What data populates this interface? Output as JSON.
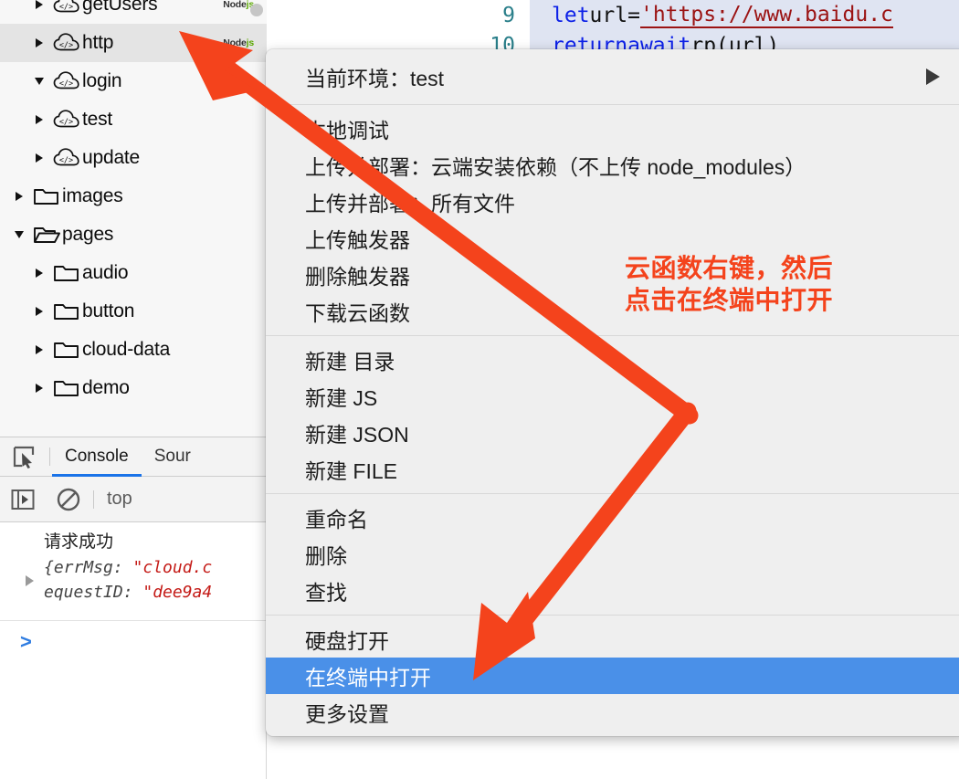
{
  "file_tree": {
    "items": [
      {
        "label": "getUsers",
        "icon": "cloud-code-icon",
        "depth": 2,
        "twisty": "right",
        "badge": "Node",
        "badge_js": "js",
        "selected": false
      },
      {
        "label": "http",
        "icon": "cloud-code-icon",
        "depth": 2,
        "twisty": "right",
        "badge": "Node",
        "badge_js": "js",
        "selected": true
      },
      {
        "label": "login",
        "icon": "cloud-code-icon",
        "depth": 2,
        "twisty": "down",
        "badge": "",
        "badge_js": "",
        "selected": false
      },
      {
        "label": "test",
        "icon": "cloud-code-icon",
        "depth": 2,
        "twisty": "right",
        "badge": "",
        "badge_js": "",
        "selected": false
      },
      {
        "label": "update",
        "icon": "cloud-code-icon",
        "depth": 2,
        "twisty": "right",
        "badge": "",
        "badge_js": "",
        "selected": false
      },
      {
        "label": "images",
        "icon": "folder-closed-icon",
        "depth": 1,
        "twisty": "right",
        "badge": "",
        "badge_js": "",
        "selected": false
      },
      {
        "label": "pages",
        "icon": "folder-open-icon",
        "depth": 1,
        "twisty": "down",
        "badge": "",
        "badge_js": "",
        "selected": false
      },
      {
        "label": "audio",
        "icon": "folder-closed-icon",
        "depth": 2,
        "twisty": "right",
        "badge": "",
        "badge_js": "",
        "selected": false
      },
      {
        "label": "button",
        "icon": "folder-closed-icon",
        "depth": 2,
        "twisty": "right",
        "badge": "",
        "badge_js": "",
        "selected": false
      },
      {
        "label": "cloud-data",
        "icon": "folder-closed-icon",
        "depth": 2,
        "twisty": "right",
        "badge": "",
        "badge_js": "",
        "selected": false
      },
      {
        "label": "demo",
        "icon": "folder-closed-icon",
        "depth": 2,
        "twisty": "right",
        "badge": "",
        "badge_js": "",
        "selected": false
      }
    ]
  },
  "devtools": {
    "inspect_icon": "inspect-element-icon",
    "tabs": [
      {
        "label": "Console",
        "active": true
      },
      {
        "label": "Sour",
        "active": false
      }
    ],
    "toolbar": {
      "sidebar_icon": "console-sidebar-icon",
      "clear_icon": "clear-console-icon",
      "context_label": "top"
    },
    "console": {
      "log_text": "请求成功",
      "object_line1_prefix": "{errMsg: ",
      "object_line1_string": "\"cloud.c",
      "object_line2_prefix": "equestID: ",
      "object_line2_string": "\"dee9a4",
      "prompt": ">"
    }
  },
  "editor": {
    "lines": [
      {
        "number": "9",
        "tokens": [
          {
            "t": "let ",
            "c": "kw"
          },
          {
            "t": "url ",
            "c": "pl"
          },
          {
            "t": "= ",
            "c": "pl"
          },
          {
            "t": "'",
            "c": "lnk"
          },
          {
            "t": "https://www.baidu.c",
            "c": "lnk"
          }
        ]
      },
      {
        "number": "10",
        "tokens": [
          {
            "t": "return ",
            "c": "kw"
          },
          {
            "t": "await ",
            "c": "kw"
          },
          {
            "t": "rp(url)",
            "c": "pl"
          }
        ]
      }
    ]
  },
  "context_menu": {
    "groups": [
      {
        "items": [
          {
            "label": "当前环境：test",
            "header": true,
            "submenu": true,
            "highlight": false
          }
        ]
      },
      {
        "items": [
          {
            "label": "本地调试",
            "header": false,
            "submenu": false,
            "highlight": false
          },
          {
            "label": "上传并部署：云端安装依赖（不上传 node_modules）",
            "header": false,
            "submenu": false,
            "highlight": false
          },
          {
            "label": "上传并部署：所有文件",
            "header": false,
            "submenu": false,
            "highlight": false
          },
          {
            "label": "上传触发器",
            "header": false,
            "submenu": false,
            "highlight": false
          },
          {
            "label": "删除触发器",
            "header": false,
            "submenu": false,
            "highlight": false
          },
          {
            "label": "下载云函数",
            "header": false,
            "submenu": false,
            "highlight": false
          }
        ]
      },
      {
        "items": [
          {
            "label": "新建 目录",
            "header": false,
            "submenu": false,
            "highlight": false
          },
          {
            "label": "新建 JS",
            "header": false,
            "submenu": false,
            "highlight": false
          },
          {
            "label": "新建 JSON",
            "header": false,
            "submenu": false,
            "highlight": false
          },
          {
            "label": "新建 FILE",
            "header": false,
            "submenu": false,
            "highlight": false
          }
        ]
      },
      {
        "items": [
          {
            "label": "重命名",
            "header": false,
            "submenu": false,
            "highlight": false
          },
          {
            "label": "删除",
            "header": false,
            "submenu": false,
            "highlight": false
          },
          {
            "label": "查找",
            "header": false,
            "submenu": false,
            "highlight": false
          }
        ]
      },
      {
        "items": [
          {
            "label": "硬盘打开",
            "header": false,
            "submenu": false,
            "highlight": false
          },
          {
            "label": "在终端中打开",
            "header": false,
            "submenu": false,
            "highlight": true
          },
          {
            "label": "更多设置",
            "header": false,
            "submenu": false,
            "highlight": false
          }
        ]
      }
    ]
  },
  "annotation": {
    "line1": "云函数右键，然后",
    "line2": "点击在终端中打开",
    "color": "#f4431c",
    "arrows": [
      "arrow-to-cloud-function",
      "arrow-to-open-in-terminal"
    ]
  }
}
